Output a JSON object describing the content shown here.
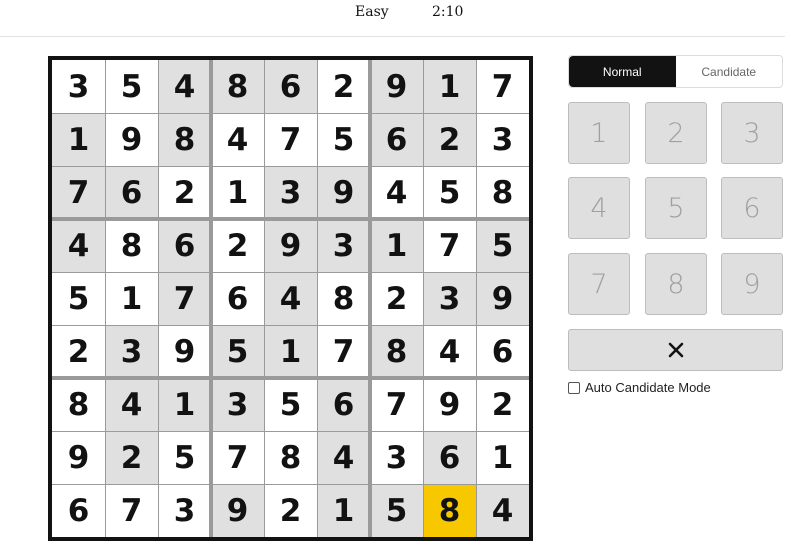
{
  "header": {
    "difficulty": "Easy",
    "timer": "2:10"
  },
  "board": {
    "selected_color": "#f7c800",
    "shaded_color": "#e0e0e0",
    "rows": [
      {
        "values": [
          3,
          5,
          4,
          8,
          6,
          2,
          9,
          1,
          7
        ],
        "shade": [
          "w",
          "w",
          "g",
          "g",
          "g",
          "w",
          "g",
          "g",
          "w"
        ]
      },
      {
        "values": [
          1,
          9,
          8,
          4,
          7,
          5,
          6,
          2,
          3
        ],
        "shade": [
          "g",
          "w",
          "g",
          "w",
          "w",
          "w",
          "g",
          "g",
          "w"
        ]
      },
      {
        "values": [
          7,
          6,
          2,
          1,
          3,
          9,
          4,
          5,
          8
        ],
        "shade": [
          "g",
          "g",
          "w",
          "w",
          "g",
          "g",
          "w",
          "w",
          "w"
        ]
      },
      {
        "values": [
          4,
          8,
          6,
          2,
          9,
          3,
          1,
          7,
          5
        ],
        "shade": [
          "g",
          "w",
          "g",
          "w",
          "g",
          "g",
          "g",
          "w",
          "g"
        ]
      },
      {
        "values": [
          5,
          1,
          7,
          6,
          4,
          8,
          2,
          3,
          9
        ],
        "shade": [
          "w",
          "w",
          "g",
          "w",
          "g",
          "w",
          "w",
          "g",
          "g"
        ]
      },
      {
        "values": [
          2,
          3,
          9,
          5,
          1,
          7,
          8,
          4,
          6
        ],
        "shade": [
          "w",
          "g",
          "w",
          "g",
          "g",
          "w",
          "g",
          "w",
          "w"
        ]
      },
      {
        "values": [
          8,
          4,
          1,
          3,
          5,
          6,
          7,
          9,
          2
        ],
        "shade": [
          "w",
          "g",
          "g",
          "g",
          "w",
          "g",
          "w",
          "w",
          "w"
        ]
      },
      {
        "values": [
          9,
          2,
          5,
          7,
          8,
          4,
          3,
          6,
          1
        ],
        "shade": [
          "w",
          "g",
          "w",
          "w",
          "w",
          "g",
          "w",
          "g",
          "w"
        ]
      },
      {
        "values": [
          6,
          7,
          3,
          9,
          2,
          1,
          5,
          8,
          4
        ],
        "shade": [
          "w",
          "w",
          "w",
          "g",
          "w",
          "g",
          "g",
          "y",
          "g"
        ]
      }
    ],
    "selected_cell": {
      "row": 9,
      "col": 8
    }
  },
  "mode_toggle": {
    "normal_label": "Normal",
    "candidate_label": "Candidate",
    "active": "Normal"
  },
  "keypad": {
    "keys": [
      "1",
      "2",
      "3",
      "4",
      "5",
      "6",
      "7",
      "8",
      "9"
    ],
    "erase_icon": "close-x-icon"
  },
  "auto_candidate": {
    "label": "Auto Candidate Mode",
    "checked": false
  }
}
